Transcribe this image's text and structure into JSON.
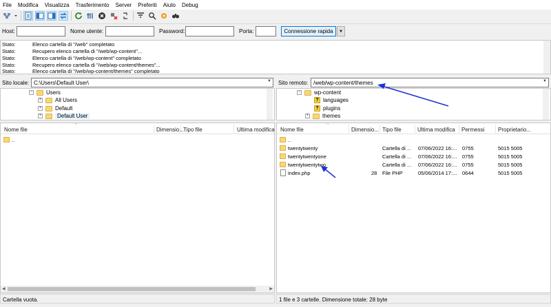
{
  "menu": [
    "File",
    "Modifica",
    "Visualizza",
    "Trasferimento",
    "Server",
    "Preferiti",
    "Aiuto",
    "Debug"
  ],
  "quickconnect": {
    "host_label": "Host:",
    "user_label": "Nome utente:",
    "pass_label": "Password:",
    "port_label": "Porta:",
    "button": "Connessione rapida"
  },
  "log": [
    {
      "k": "Stato:",
      "v": "Elenco cartella di \"/web\" completato"
    },
    {
      "k": "Stato:",
      "v": "Recupero elenco cartella di \"/web/wp-content\"..."
    },
    {
      "k": "Stato:",
      "v": "Elenco cartella di \"/web/wp-content\" completato"
    },
    {
      "k": "Stato:",
      "v": "Recupero elenco cartella di \"/web/wp-content/themes\"..."
    },
    {
      "k": "Stato:",
      "v": "Elenco cartella di \"/web/wp-content/themes\" completato"
    }
  ],
  "local": {
    "site_label": "Sito locale:",
    "path": "C:\\Users\\Default User\\",
    "tree": [
      "Users",
      "All Users",
      "Default",
      "Default User"
    ],
    "columns": [
      "Nome file",
      "Dimensio...",
      "Tipo file",
      "Ultima modifica"
    ],
    "rows": [
      ".."
    ],
    "status": "Cartella vuota."
  },
  "remote": {
    "site_label": "Sito remoto:",
    "path": "/web/wp-content/themes",
    "tree": [
      "wp-content",
      "languages",
      "plugins",
      "themes"
    ],
    "columns": [
      "Nome file",
      "Dimensio...",
      "Tipo file",
      "Ultima modifica",
      "Permessi",
      "Proprietario..."
    ],
    "rows": [
      {
        "name": "..",
        "size": "",
        "type": "",
        "date": "",
        "perm": "",
        "owner": ""
      },
      {
        "name": "twentytwenty",
        "size": "",
        "type": "Cartella di ...",
        "date": "07/06/2022 16:...",
        "perm": "0755",
        "owner": "5015 5005"
      },
      {
        "name": "twentytwentyone",
        "size": "",
        "type": "Cartella di ...",
        "date": "07/06/2022 16:...",
        "perm": "0755",
        "owner": "5015 5005"
      },
      {
        "name": "twentytwentytwo",
        "size": "",
        "type": "Cartella di ...",
        "date": "07/06/2022 16:...",
        "perm": "0755",
        "owner": "5015 5005"
      },
      {
        "name": "index.php",
        "size": "28",
        "type": "File PHP",
        "date": "05/06/2014 17:...",
        "perm": "0644",
        "owner": "5015 5005"
      }
    ],
    "status": "1 file e 3 cartelle. Dimensione totale: 28 byte"
  },
  "colors": {
    "annotation_arrow": "#1f2fd6",
    "selection": "#e5f3ff",
    "folder": "#f8d775"
  }
}
